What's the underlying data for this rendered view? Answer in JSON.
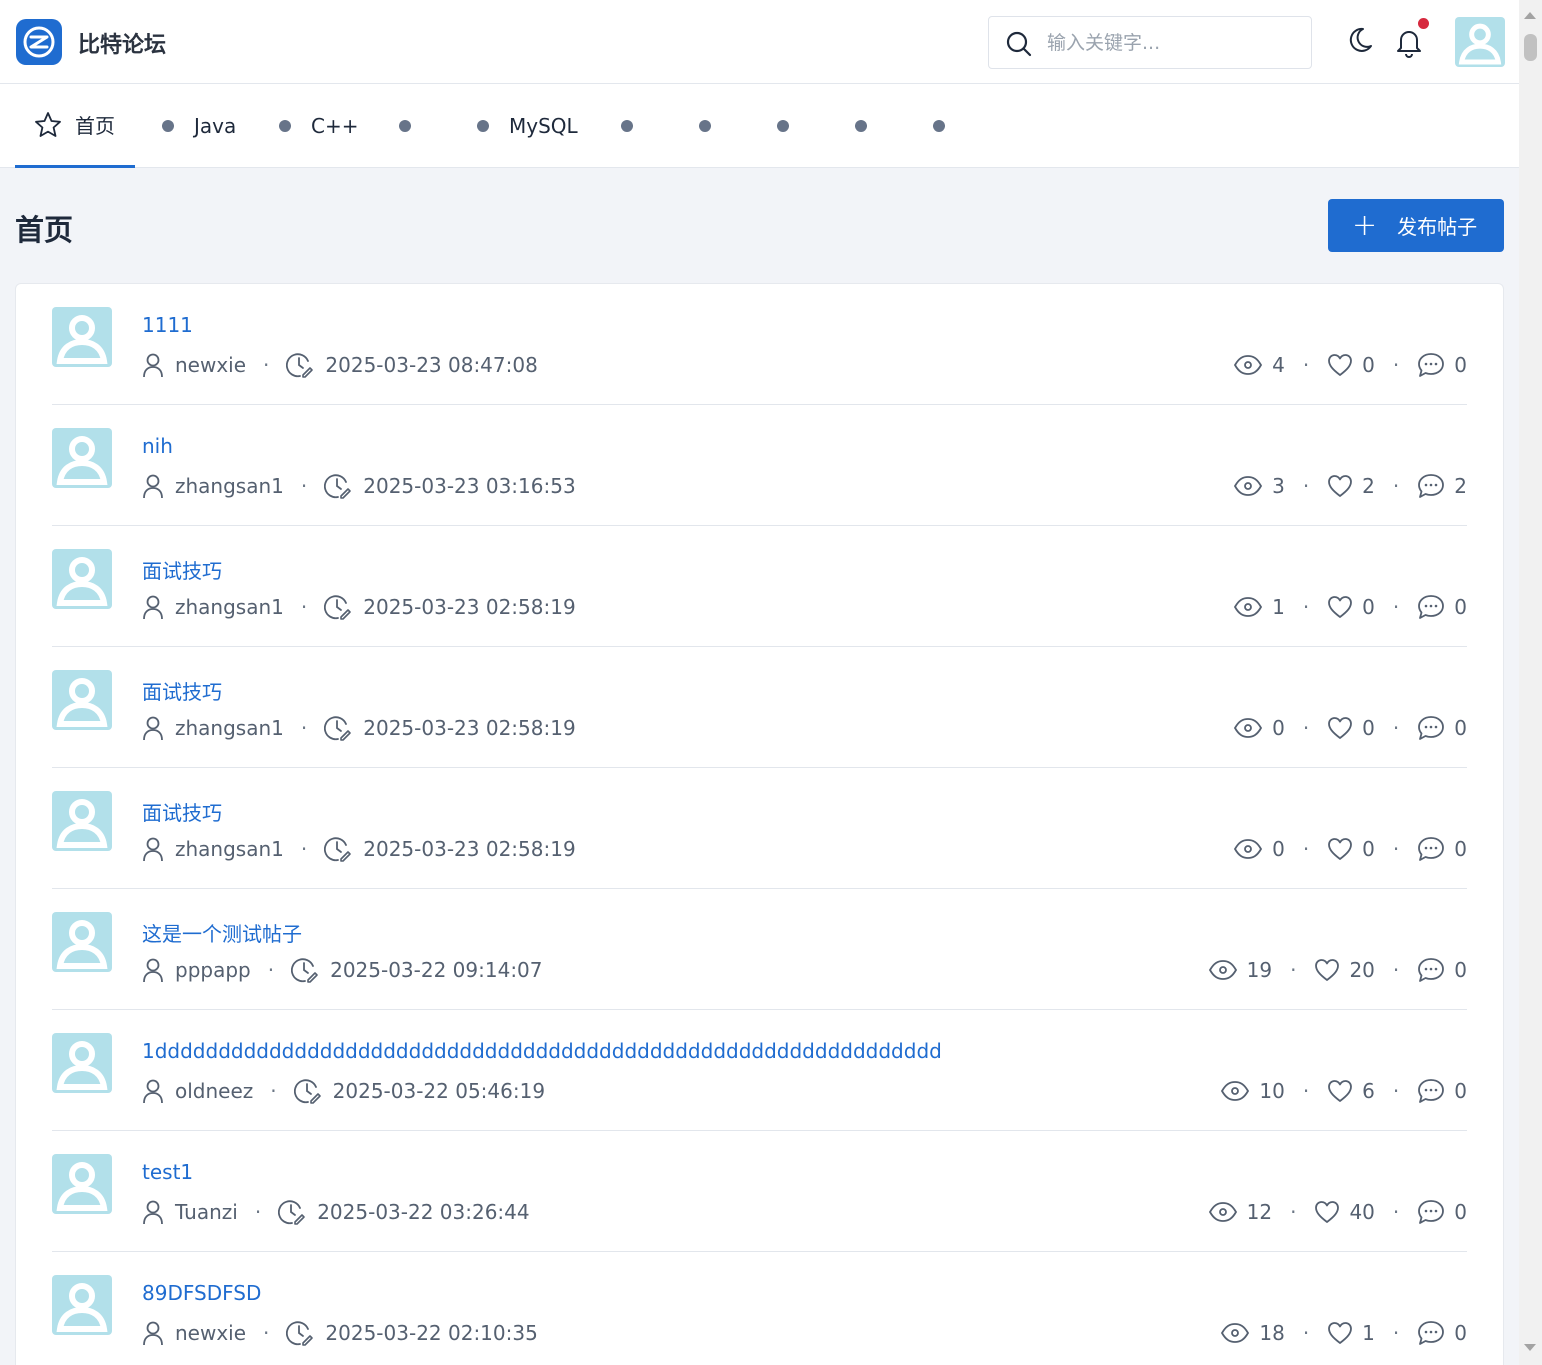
{
  "header": {
    "brand": "比特论坛",
    "search_placeholder": "输入关键字...",
    "icons": [
      "moon-icon",
      "bell-icon",
      "avatar"
    ],
    "notification_dot_color": "#d6293e"
  },
  "nav": {
    "tabs": [
      {
        "label": "首页",
        "active": true,
        "icon": "star-icon"
      },
      {
        "label": "Java",
        "icon": "dot"
      },
      {
        "label": "C++",
        "icon": "dot"
      },
      {
        "label": "",
        "icon": "dot"
      },
      {
        "label": "MySQL",
        "icon": "dot"
      },
      {
        "label": "",
        "icon": "dot"
      },
      {
        "label": "",
        "icon": "dot"
      },
      {
        "label": "",
        "icon": "dot"
      },
      {
        "label": "",
        "icon": "dot"
      },
      {
        "label": "",
        "icon": "dot"
      }
    ]
  },
  "main": {
    "page_title": "首页",
    "publish_label": "发布帖子",
    "accent_color": "#1f6cd0"
  },
  "posts": [
    {
      "title": "1111",
      "author": "newxie",
      "time": "2025-03-23 08:47:08",
      "views": "4",
      "likes": "0",
      "comments": "0"
    },
    {
      "title": "nih",
      "author": "zhangsan1",
      "time": "2025-03-23 03:16:53",
      "views": "3",
      "likes": "2",
      "comments": "2"
    },
    {
      "title": "面试技巧",
      "author": "zhangsan1",
      "time": "2025-03-23 02:58:19",
      "views": "1",
      "likes": "0",
      "comments": "0"
    },
    {
      "title": "面试技巧",
      "author": "zhangsan1",
      "time": "2025-03-23 02:58:19",
      "views": "0",
      "likes": "0",
      "comments": "0"
    },
    {
      "title": "面试技巧",
      "author": "zhangsan1",
      "time": "2025-03-23 02:58:19",
      "views": "0",
      "likes": "0",
      "comments": "0"
    },
    {
      "title": "这是一个测试帖子",
      "author": "pppapp",
      "time": "2025-03-22 09:14:07",
      "views": "19",
      "likes": "20",
      "comments": "0"
    },
    {
      "title": "1dddddddddddddddddddddddddddddddddddddddddddddddddddddddddddddd",
      "author": "oldneez",
      "time": "2025-03-22 05:46:19",
      "views": "10",
      "likes": "6",
      "comments": "0"
    },
    {
      "title": "test1",
      "author": "Tuanzi",
      "time": "2025-03-22 03:26:44",
      "views": "12",
      "likes": "40",
      "comments": "0"
    },
    {
      "title": "89DFSDFSD",
      "author": "newxie",
      "time": "2025-03-22 02:10:35",
      "views": "18",
      "likes": "1",
      "comments": "0"
    }
  ]
}
